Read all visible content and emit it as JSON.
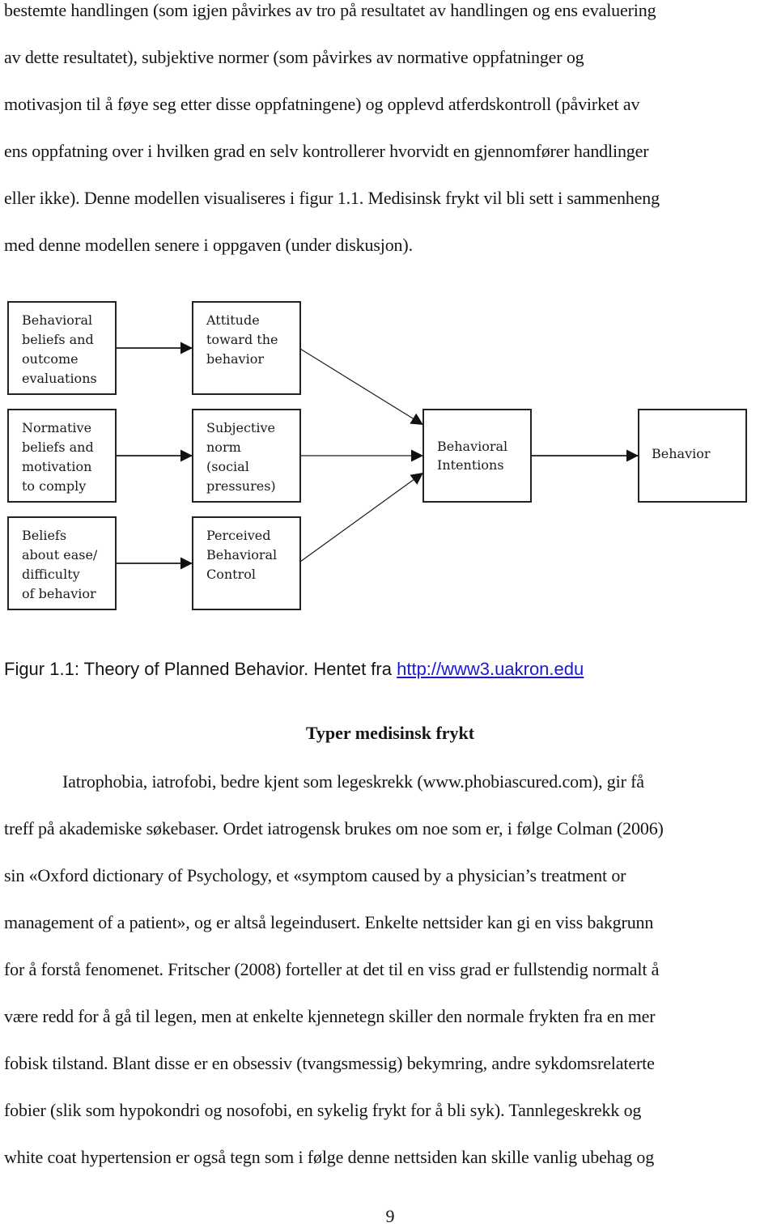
{
  "intro_paragraph": {
    "lines": [
      "bestemte handlingen (som igjen påvirkes av tro på resultatet av handlingen og ens evaluering",
      "av dette resultatet), subjektive normer (som påvirkes av normative oppfatninger og",
      "motivasjon til å føye seg etter disse oppfatningene) og opplevd atferdskontroll (påvirket av",
      "ens oppfatning over i hvilken grad en selv kontrollerer hvorvidt en gjennomfører handlinger",
      "eller ikke). Denne modellen visualiseres i figur 1.1. Medisinsk frykt vil bli sett i sammenheng",
      "med denne modellen senere i oppgaven (under diskusjon)."
    ]
  },
  "figure": {
    "boxes": {
      "behavioral_beliefs": [
        "Behavioral",
        "beliefs and",
        "outcome",
        "evaluations"
      ],
      "normative_beliefs": [
        "Normative",
        "beliefs and",
        "motivation",
        "to comply"
      ],
      "control_beliefs": [
        "Beliefs",
        "about ease/",
        "difficulty",
        "of behavior"
      ],
      "attitude": [
        "Attitude",
        "toward the",
        "behavior"
      ],
      "subjective_norm": [
        "Subjective",
        "norm",
        "(social",
        "pressures)"
      ],
      "perceived_control": [
        "Perceived",
        "Behavioral",
        "Control"
      ],
      "intentions": [
        "Behavioral",
        "Intentions"
      ],
      "behavior": [
        "Behavior"
      ]
    },
    "edges": [
      [
        "behavioral_beliefs",
        "attitude"
      ],
      [
        "normative_beliefs",
        "subjective_norm"
      ],
      [
        "control_beliefs",
        "perceived_control"
      ],
      [
        "attitude",
        "intentions"
      ],
      [
        "subjective_norm",
        "intentions"
      ],
      [
        "perceived_control",
        "intentions"
      ],
      [
        "intentions",
        "behavior"
      ]
    ]
  },
  "caption": {
    "text": "Figur 1.1: Theory of Planned Behavior. Hentet fra ",
    "link_text": "http://www3.uakron.edu",
    "link_color": "#1a1acc"
  },
  "section": {
    "heading": "Typer medisinsk frykt",
    "lines": [
      "Iatrophobia, iatrofobi, bedre kjent som legeskrekk (www.phobiascured.com), gir få",
      "treff på akademiske søkebaser. Ordet iatrogensk brukes om noe som er, i følge Colman (2006)",
      "sin «Oxford dictionary of Psychology, et «symptom caused by a physician’s treatment or",
      "management of a patient», og er altså legeindusert. Enkelte nettsider kan gi en viss bakgrunn",
      "for å forstå fenomenet. Fritscher (2008) forteller at det til en viss grad er fullstendig normalt å",
      "være redd for å gå til legen, men at enkelte kjennetegn skiller den normale frykten fra en mer",
      "fobisk tilstand. Blant disse er en obsessiv (tvangsmessig) bekymring, andre sykdomsrelaterte",
      "fobier (slik som hypokondri og nosofobi, en sykelig frykt for å bli syk). Tannlegeskrekk og",
      "white coat hypertension er også tegn som i følge denne nettsiden kan skille vanlig ubehag og"
    ]
  },
  "page_number": "9"
}
